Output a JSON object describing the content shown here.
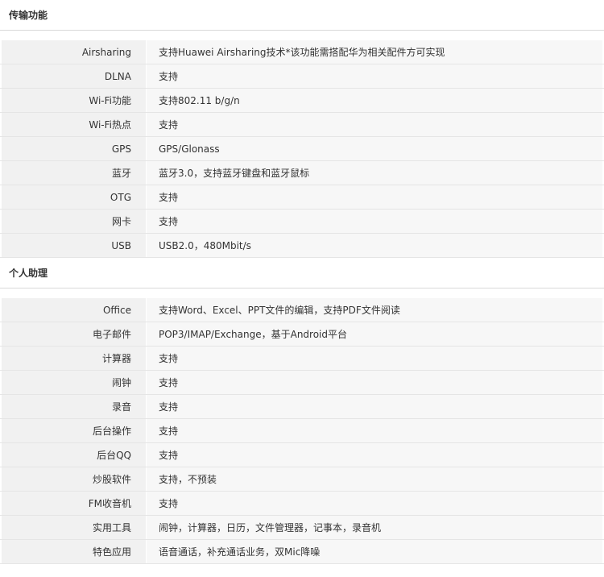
{
  "sections": [
    {
      "title": "传输功能",
      "rows": [
        {
          "label": "Airsharing",
          "value": "支持Huawei Airsharing技术*该功能需搭配华为相关配件方可实现"
        },
        {
          "label": "DLNA",
          "value": "支持"
        },
        {
          "label": "Wi-Fi功能",
          "value": "支持802.11 b/g/n"
        },
        {
          "label": "Wi-Fi热点",
          "value": "支持"
        },
        {
          "label": "GPS",
          "value": "GPS/Glonass"
        },
        {
          "label": "蓝牙",
          "value": "蓝牙3.0，支持蓝牙键盘和蓝牙鼠标"
        },
        {
          "label": "OTG",
          "value": "支持"
        },
        {
          "label": "网卡",
          "value": "支持"
        },
        {
          "label": "USB",
          "value": "USB2.0，480Mbit/s"
        }
      ]
    },
    {
      "title": "个人助理",
      "rows": [
        {
          "label": "Office",
          "value": "支持Word、Excel、PPT文件的编辑，支持PDF文件阅读"
        },
        {
          "label": "电子邮件",
          "value": "POP3/IMAP/Exchange，基于Android平台"
        },
        {
          "label": "计算器",
          "value": "支持"
        },
        {
          "label": "闹钟",
          "value": "支持"
        },
        {
          "label": "录音",
          "value": "支持"
        },
        {
          "label": "后台操作",
          "value": "支持"
        },
        {
          "label": "后台QQ",
          "value": "支持"
        },
        {
          "label": "炒股软件",
          "value": "支持，不预装"
        },
        {
          "label": "FM收音机",
          "value": "支持"
        },
        {
          "label": "实用工具",
          "value": "闹钟，计算器，日历，文件管理器，记事本，录音机"
        },
        {
          "label": "特色应用",
          "value": "语音通话，补充通话业务，双Mic降噪"
        }
      ]
    }
  ]
}
